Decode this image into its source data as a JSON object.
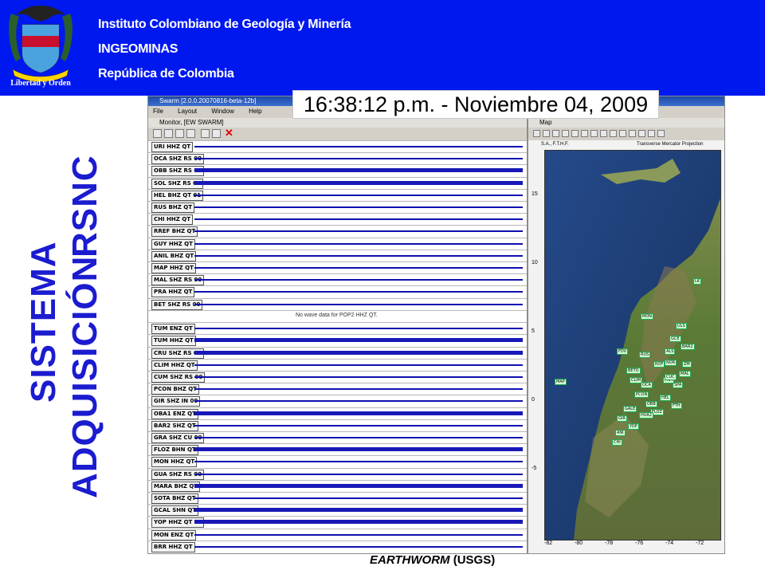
{
  "header": {
    "institute": "Instituto Colombiano de Geología y Minería",
    "acronym": "INGEOMINAS",
    "country": "República de Colombia",
    "motto": "Libertad y Orden",
    "banner_color": "#0018f0"
  },
  "side_title": {
    "line1": "SISTEMA",
    "line2a": "ADQUISICIÓN",
    "line2b": "RSNC",
    "color": "#1b1bd0"
  },
  "timestamp": "16:38:12 p.m. - Noviembre 04, 2009",
  "credit": {
    "main": "EARTHWORM",
    "suffix": "(USGS)"
  },
  "app": {
    "window_title": "Swarm [2.0.0.20070816-beta-12b]",
    "menu": [
      "File",
      "Layout",
      "Window",
      "Help"
    ],
    "monitor_title": "Monitor, [EW SWARM]",
    "map_title": "Map",
    "no_data_message": "No wave data for POP2 HHZ QT.",
    "map_projection": "Transverse Mercator Projection",
    "map_scale": "S.A., F.T.H.F.",
    "channels": [
      "URI HHZ QT",
      "OCA SHZ RS 00",
      "OBB SHZ RS 00",
      "SOL SHZ RS 00",
      "HEL BHZ QT 01",
      "RUS BHZ QT",
      "CHI HHZ QT",
      "RREF BHZ QT",
      "GUY HHZ QT",
      "ANIL BHZ QT",
      "MAP HHZ QT",
      "MAL SHZ RS 00",
      "PRA HHZ QT",
      "BET SHZ RS 00",
      "",
      "TUM ENZ QT",
      "TUM HHZ QT",
      "CRU SHZ RS 00",
      "CLIM HHZ QT",
      "CUM SHZ RS 00",
      "PCON BHZ QT",
      "GIR SHZ IN 00",
      "OBA1 ENZ QT",
      "BAR2 SHZ QT",
      "GRA SHZ CU 00",
      "FLOZ BHN QT",
      "MON HHZ QT",
      "GUA SHZ RS 00",
      "MARA BHZ QT",
      "SOTA BHZ QT",
      "GCAL SHN QT",
      "YOP HHZ QT 01",
      "MON ENZ QT",
      "BRR HHZ QT"
    ],
    "map_lat_labels": [
      "15",
      "10",
      "5",
      "0",
      "-5"
    ],
    "map_lon_labels": [
      "-82",
      "-80",
      "-78",
      "-76",
      "-74",
      "-72"
    ],
    "stations": [
      "LK",
      "MON",
      "ULS",
      "GCE",
      "BAR2",
      "ALS",
      "FDV",
      "NOR",
      "ZM",
      "ROF",
      "RUS",
      "MAL",
      "SPA",
      "BETO",
      "CLIM",
      "PRA",
      "OCA",
      "CUC",
      "MAP",
      "PCON",
      "HEL",
      "GALE",
      "OBB",
      "FLOZ",
      "HUA2",
      "GIR",
      "YOP",
      "FTH",
      "ANI",
      "CHI"
    ]
  }
}
